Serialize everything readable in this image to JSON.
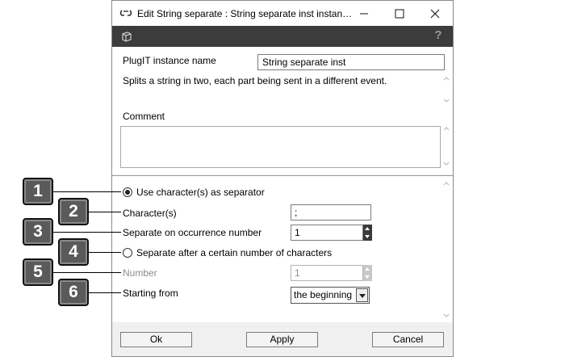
{
  "window": {
    "title": "Edit String separate : String separate inst instan…"
  },
  "icons": {
    "title": "link-icon",
    "minimize": "minimize-icon",
    "maximize": "maximize-icon",
    "close": "close-icon",
    "toolbar": "cube-icon",
    "help": "help-icon"
  },
  "toolbar": {
    "help_glyph": "?"
  },
  "instance": {
    "label": "PlugIT instance name",
    "value": "String separate inst"
  },
  "description": "Splits a string in two, each part being sent in a different event.",
  "comment": {
    "label": "Comment",
    "value": ""
  },
  "options": {
    "use_separator_label": "Use character(s) as separator",
    "characters_label": "Character(s)",
    "characters_value": ";",
    "occurrence_label": "Separate on occurrence number",
    "occurrence_value": "1",
    "after_chars_label": "Separate after a certain number of characters",
    "number_label": "Number",
    "number_value": "1",
    "starting_label": "Starting from",
    "starting_value": "the beginning"
  },
  "buttons": {
    "ok": "Ok",
    "apply": "Apply",
    "cancel": "Cancel"
  },
  "callouts": [
    "1",
    "2",
    "3",
    "4",
    "5",
    "6"
  ]
}
